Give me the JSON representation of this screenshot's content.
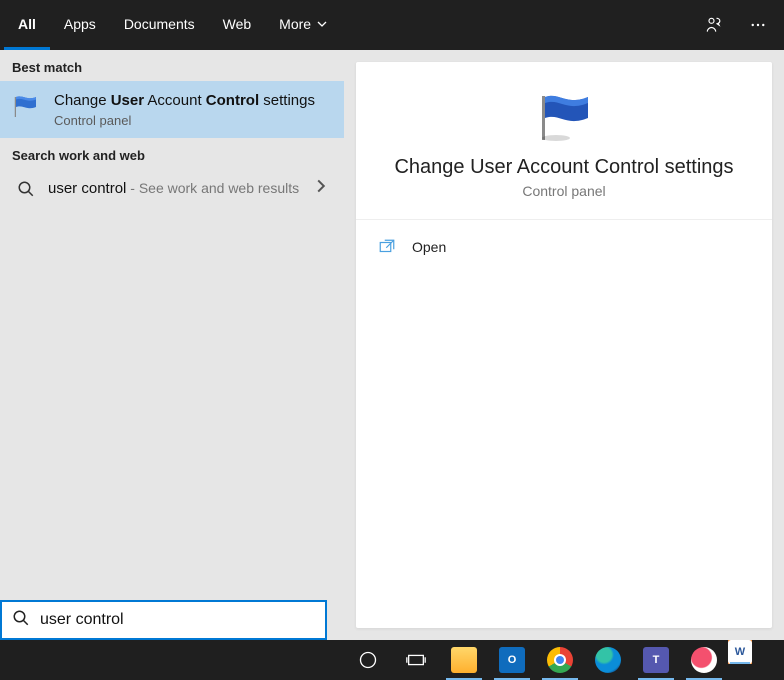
{
  "tabs": {
    "all": "All",
    "apps": "Apps",
    "documents": "Documents",
    "web": "Web",
    "more": "More"
  },
  "left": {
    "best_match_label": "Best match",
    "result_title_pre": "Change ",
    "result_title_b1": "User",
    "result_title_mid": " Account ",
    "result_title_b2": "Control",
    "result_title_post": " settings",
    "result_sub": "Control panel",
    "search_section_label": "Search work and web",
    "web_query": "user control",
    "web_suffix": " - See work and web results"
  },
  "detail": {
    "title": "Change User Account Control settings",
    "sub": "Control panel",
    "open_label": "Open"
  },
  "search": {
    "value": "user control"
  },
  "taskbar": {
    "outlook": "O",
    "teams": "T",
    "word": "W"
  }
}
